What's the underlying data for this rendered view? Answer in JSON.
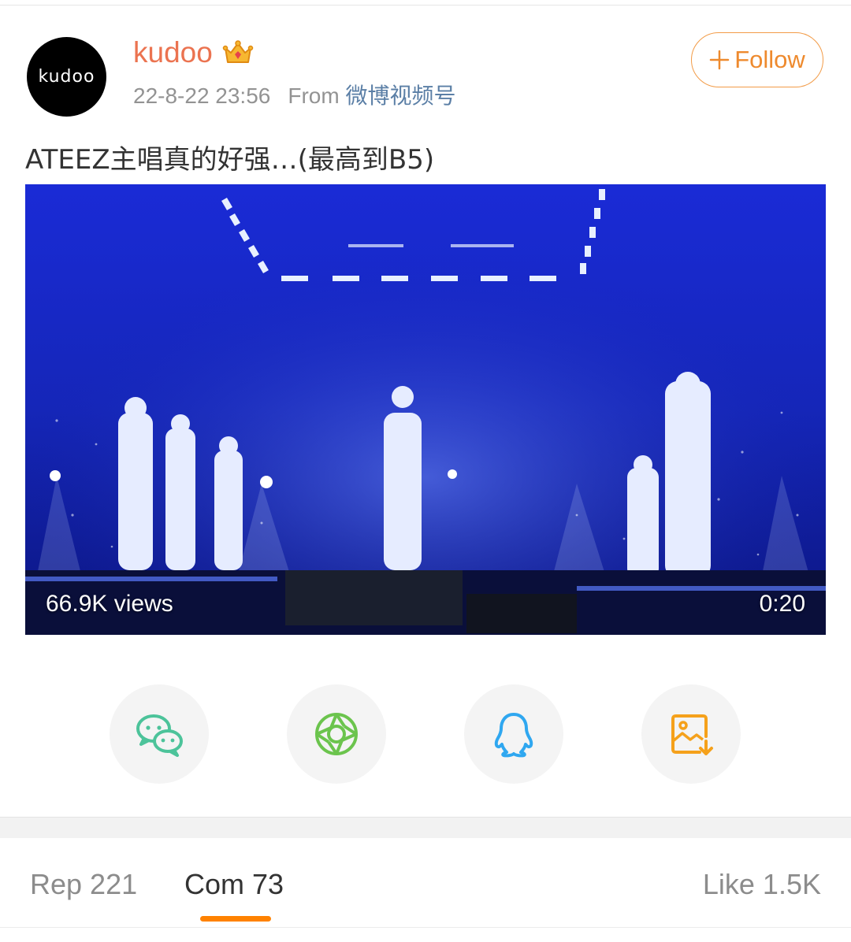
{
  "post": {
    "avatar_text": "kudoo",
    "username": "kudoo",
    "timestamp": "22-8-22 23:56",
    "source_prefix": "From",
    "source": "微博视频号",
    "follow_label": "Follow",
    "text": "ATEEZ主唱真的好强…(最高到B5)"
  },
  "video": {
    "views": "66.9K views",
    "duration": "0:20"
  },
  "share": [
    {
      "name": "wechat-icon",
      "color": "#4cc39a"
    },
    {
      "name": "moments-icon",
      "color": "#6bc44d"
    },
    {
      "name": "qq-icon",
      "color": "#2fa7f0"
    },
    {
      "name": "save-image-icon",
      "color": "#f5a11b"
    }
  ],
  "tabs": {
    "reposts": "Rep 221",
    "comments": "Com 73",
    "likes": "Like 1.5K",
    "active": "comments"
  },
  "colors": {
    "username": "#eb7350",
    "follow": "#ee8a2e",
    "source_link": "#5b7fa6",
    "tab_underline": "#ff8200"
  }
}
